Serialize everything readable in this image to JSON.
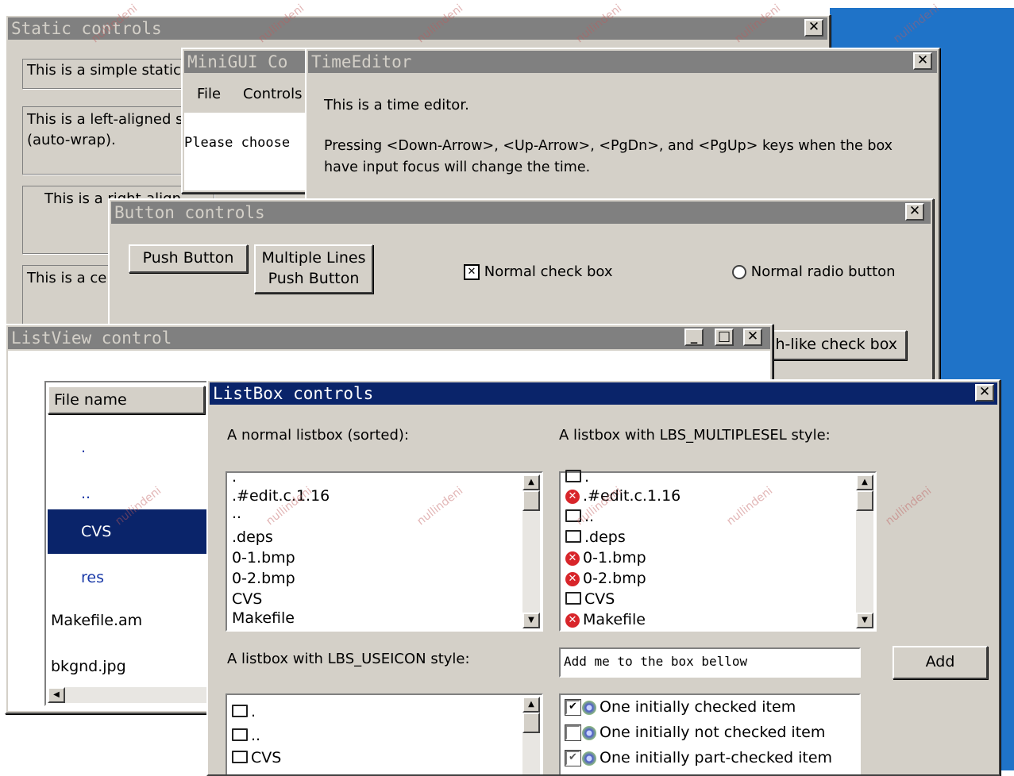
{
  "static_win": {
    "title": "Static controls",
    "close": "✕",
    "items": [
      "This is a simple static",
      "This is a left-aligned s",
      "(auto-wrap).",
      "This is a right-align",
      "This is a ce"
    ]
  },
  "minigui_win": {
    "title": "MiniGUI Co",
    "menu_file": "File",
    "menu_controls": "Controls",
    "prompt": "Please choose"
  },
  "timeeditor_win": {
    "title": "TimeEditor",
    "close": "✕",
    "line1": "This is a time editor.",
    "line2": "Pressing <Down-Arrow>, <Up-Arrow>, <PgDn>, and <PgUp> keys when the box",
    "line3": "have input focus will change the time."
  },
  "button_win": {
    "title": "Button controls",
    "close": "✕",
    "push_button": "Push Button",
    "multi_line1": "Multiple Lines",
    "multi_line2": "Push Button",
    "check_mark": "✕",
    "check_label": "Normal check box",
    "radio_label": "Normal radio button",
    "pushlike_label": "h-like check box"
  },
  "listview_win": {
    "title": "ListView control",
    "minimize": "_",
    "maximize": "□",
    "close": "✕",
    "column_header": "File name",
    "rows": [
      ".",
      "..",
      "CVS",
      "res",
      "Makefile.am",
      "bkgnd.jpg"
    ]
  },
  "listbox_win": {
    "title": "ListBox controls",
    "close": "✕",
    "normal_label": "A normal listbox (sorted):",
    "normal_items": [
      ".",
      ".#edit.c.1.16",
      "..",
      ".deps",
      "0-1.bmp",
      "0-2.bmp",
      "CVS",
      "Makefile"
    ],
    "multi_label": "A listbox with LBS_MULTIPLESEL style:",
    "multi_items": [
      {
        "icon": "folder-icon",
        "text": "."
      },
      {
        "icon": "error-icon",
        "text": ".#edit.c.1.16"
      },
      {
        "icon": "folder-icon",
        "text": ".."
      },
      {
        "icon": "folder-icon",
        "text": ".deps"
      },
      {
        "icon": "error-icon",
        "text": "0-1.bmp"
      },
      {
        "icon": "error-icon",
        "text": "0-2.bmp"
      },
      {
        "icon": "folder-icon",
        "text": "CVS"
      },
      {
        "icon": "error-icon",
        "text": "Makefile"
      }
    ],
    "useicon_label": "A listbox with LBS_USEICON style:",
    "useicon_items": [
      ".",
      "..",
      "CVS"
    ],
    "add_input_value": "Add me to the box bellow",
    "add_button": "Add",
    "check_items": [
      {
        "state": "checked",
        "text": "One initially checked item"
      },
      {
        "state": "unchecked",
        "text": "One initially not checked item"
      },
      {
        "state": "part-checked",
        "text": "One initially part-checked item"
      }
    ]
  },
  "watermark": "nullindeni",
  "colors": {
    "desktop": "#1f73c8",
    "active_title": "#0a246a",
    "inactive_title": "#808080",
    "face": "#d4d0c8"
  }
}
